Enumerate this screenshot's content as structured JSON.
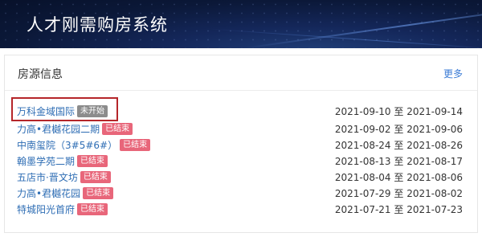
{
  "app": {
    "title": "人才刚需购房系统"
  },
  "panel": {
    "title": "房源信息",
    "more_label": "更多",
    "items": [
      {
        "name": "万科金域国际",
        "status": "未开始",
        "status_color": "#8c8c8c",
        "start": "2021-09-10",
        "to": "至",
        "end": "2021-09-14"
      },
      {
        "name": "力高•君樾花园二期",
        "status": "已结束",
        "status_color": "#e8667a",
        "start": "2021-09-02",
        "to": "至",
        "end": "2021-09-06"
      },
      {
        "name": "中南玺院（3#5#6#）",
        "status": "已结束",
        "status_color": "#e8667a",
        "start": "2021-08-24",
        "to": "至",
        "end": "2021-08-26"
      },
      {
        "name": "翰墨学苑二期",
        "status": "已结束",
        "status_color": "#e8667a",
        "start": "2021-08-13",
        "to": "至",
        "end": "2021-08-17"
      },
      {
        "name": "五店市·晋文坊",
        "status": "已结束",
        "status_color": "#e8667a",
        "start": "2021-08-04",
        "to": "至",
        "end": "2021-08-06"
      },
      {
        "name": "力高•君樾花园",
        "status": "已结束",
        "status_color": "#e8667a",
        "start": "2021-07-29",
        "to": "至",
        "end": "2021-08-02"
      },
      {
        "name": "特城阳光首府",
        "status": "已结束",
        "status_color": "#e8667a",
        "start": "2021-07-21",
        "to": "至",
        "end": "2021-07-23"
      }
    ]
  }
}
